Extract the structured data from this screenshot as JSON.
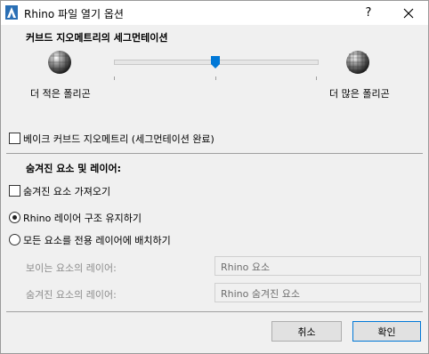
{
  "window": {
    "title": "Rhino 파일 열기 옵션",
    "help_label": "?",
    "close_icon": "close-icon"
  },
  "curved_geometry": {
    "section_label": "커브드 지오메트리의 세그먼테이션",
    "fewer_label": "더 적은 폴리곤",
    "more_label": "더 많은 폴리곤",
    "slider_value": 0.5
  },
  "bake_checkbox": {
    "label": "베이크 커브드 지오메트리 (세그먼테이션 완료)",
    "checked": false
  },
  "hidden_section": {
    "label": "숨겨진 요소 및 레이어:",
    "import_hidden_label": "숨겨진 요소 가져오기",
    "import_hidden_checked": false,
    "radio_keep_label": "Rhino 레이어 구조 유지하기",
    "radio_dedicated_label": "모든 요소를 전용 레이어에 배치하기",
    "selected": "keep"
  },
  "layers": {
    "visible_label": "보이는 요소의 레이어:",
    "visible_value": "Rhino 요소",
    "hidden_label": "숨겨진 요소의 레이어:",
    "hidden_value": "Rhino 숨겨진 요소"
  },
  "buttons": {
    "cancel": "취소",
    "ok": "확인"
  },
  "colors": {
    "accent": "#0078d7",
    "dialog_bg": "#f0f0f0"
  }
}
